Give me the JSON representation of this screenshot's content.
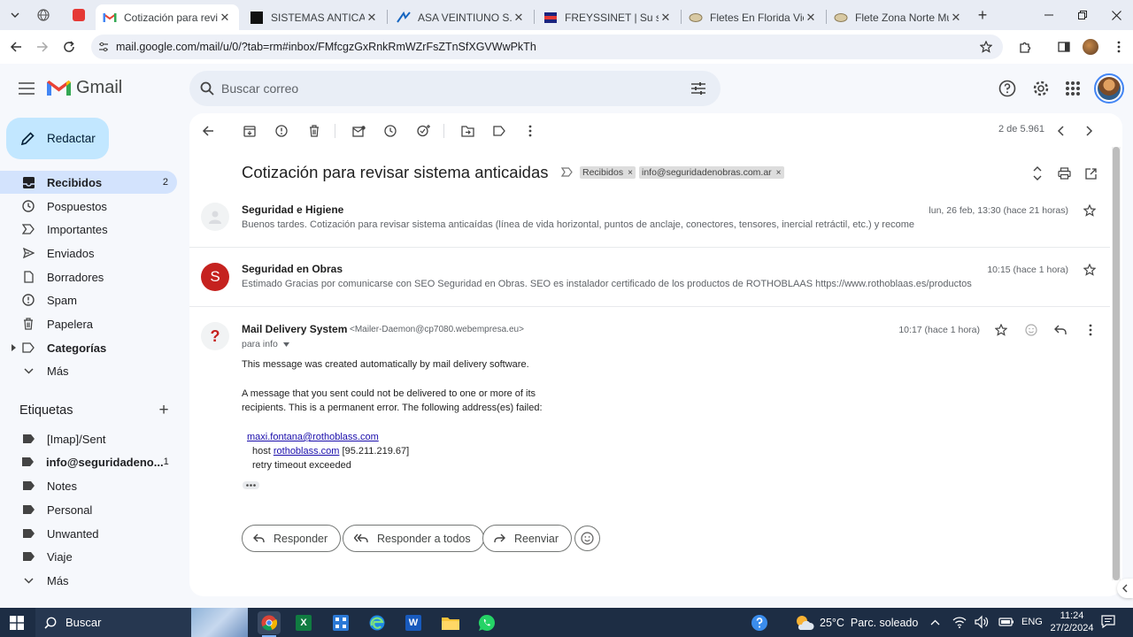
{
  "browser": {
    "tabs": [
      {
        "title": "Cotización para revisar s",
        "active": true
      },
      {
        "title": "SISTEMAS ANTICAÍDAS",
        "active": false
      },
      {
        "title": "ASA VEINTIUNO S.A. CU",
        "active": false
      },
      {
        "title": "FREYSSINET | Su socio e",
        "active": false
      },
      {
        "title": "Fletes En Florida Vicente",
        "active": false
      },
      {
        "title": "Flete Zona Norte Munro",
        "active": false
      }
    ],
    "url": "mail.google.com/mail/u/0/?tab=rm#inbox/FMfcgzGxRnkRmWZrFsZTnSfXGVWwPkTh"
  },
  "gmail": {
    "brand": "Gmail",
    "search_placeholder": "Buscar correo",
    "compose_label": "Redactar",
    "nav": [
      {
        "label": "Recibidos",
        "count": "2",
        "icon": "inbox-icon",
        "active": true
      },
      {
        "label": "Pospuestos",
        "count": "",
        "icon": "clock-icon"
      },
      {
        "label": "Importantes",
        "count": "",
        "icon": "label-important-icon"
      },
      {
        "label": "Enviados",
        "count": "",
        "icon": "send-icon"
      },
      {
        "label": "Borradores",
        "count": "",
        "icon": "draft-icon"
      },
      {
        "label": "Spam",
        "count": "",
        "icon": "spam-icon"
      },
      {
        "label": "Papelera",
        "count": "",
        "icon": "trash-icon"
      },
      {
        "label": "Categorías",
        "count": "",
        "icon": "category-icon",
        "bold": true
      },
      {
        "label": "Más",
        "count": "",
        "icon": "chevron-down-icon"
      }
    ],
    "labels_heading": "Etiquetas",
    "labels": [
      {
        "label": "[Imap]/Sent",
        "count": ""
      },
      {
        "label": "info@seguridadeno...",
        "count": "1",
        "bold": true
      },
      {
        "label": "Notes",
        "count": ""
      },
      {
        "label": "Personal",
        "count": ""
      },
      {
        "label": "Unwanted",
        "count": ""
      },
      {
        "label": "Viaje",
        "count": ""
      }
    ],
    "labels_more": "Más"
  },
  "thread": {
    "pagination": "2 de 5.961",
    "subject": "Cotización para revisar sistema anticaidas",
    "chips": [
      "Recibidos",
      "info@seguridadenobras.com.ar"
    ],
    "messages": [
      {
        "sender": "Seguridad e Higiene",
        "date": "lun, 26 feb, 13:30 (hace 21 horas)",
        "snippet": "Buenos tardes. Cotización para revisar sistema anticaídas (línea de vida horizontal, puntos de anclaje, conectores, tensores, inercial retráctil, etc.) y recome"
      },
      {
        "sender": "Seguridad en Obras",
        "avatar_letter": "S",
        "date": "10:15 (hace 1 hora)",
        "snippet": "Estimado Gracias por comunicarse con SEO Seguridad en Obras. SEO es instalador certificado de los productos de ROTHOBLAAS https://www.rothoblaas.es/productos/si"
      },
      {
        "sender": "Mail Delivery System",
        "email": "<Mailer-Daemon@cp7080.webempresa.eu>",
        "to": "para info",
        "date": "10:17 (hace 1 hora)",
        "avatar_letter": "?",
        "body": {
          "line1": "This message was created automatically by mail delivery software.",
          "line2": "A message that you sent could not be delivered to one or more of its",
          "line3": "recipients. This is a permanent error. The following address(es) failed:",
          "failed_address": "maxi.fontana@rothoblass.com",
          "host_prefix": "host",
          "host_link": "rothoblass.com",
          "host_ip": "[95.211.219.67]",
          "line_retry": "retry timeout exceeded"
        }
      }
    ],
    "actions": {
      "reply": "Responder",
      "reply_all": "Responder a todos",
      "forward": "Reenviar"
    }
  },
  "taskbar": {
    "search": "Buscar",
    "weather": "25°C  Parc. soleado",
    "lang": "ENG",
    "time": "11:24",
    "date": "27/2/2024"
  },
  "colors": {
    "accent": "#0b57d0",
    "selected_nav": "#d3e3fd",
    "compose": "#c2e7ff",
    "avatar_s": "#c5221f"
  }
}
